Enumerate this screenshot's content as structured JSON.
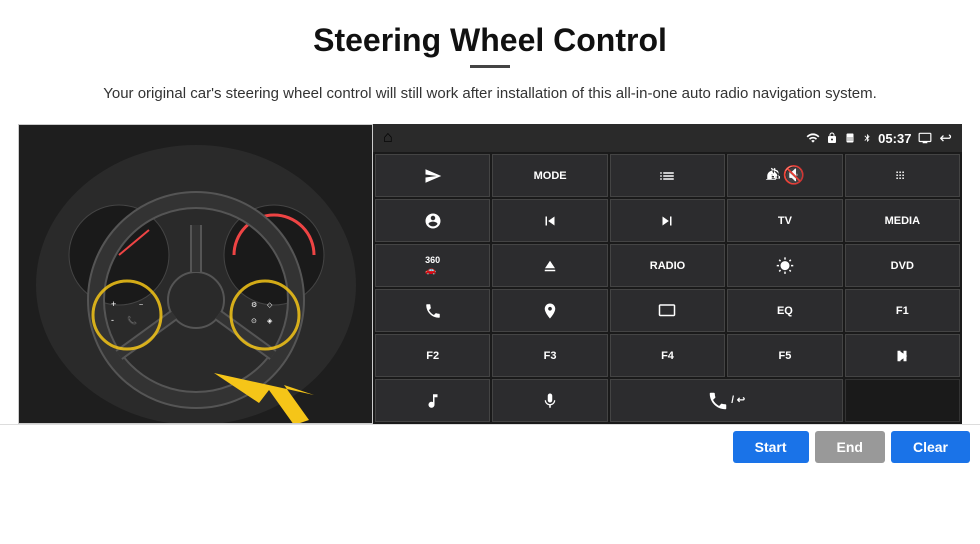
{
  "header": {
    "title": "Steering Wheel Control",
    "subtitle": "Your original car's steering wheel control will still work after installation of this all-in-one auto radio navigation system."
  },
  "status_bar": {
    "home_icon": "⌂",
    "time": "05:37",
    "back_icon": "↩"
  },
  "grid_buttons": [
    {
      "id": "r1c1",
      "icon": "arrow",
      "label": ""
    },
    {
      "id": "r1c2",
      "label": "MODE"
    },
    {
      "id": "r1c3",
      "icon": "list"
    },
    {
      "id": "r1c4",
      "icon": "mute"
    },
    {
      "id": "r1c5",
      "icon": "apps"
    },
    {
      "id": "r2c1",
      "icon": "settings-circle"
    },
    {
      "id": "r2c2",
      "icon": "prev"
    },
    {
      "id": "r2c3",
      "icon": "next"
    },
    {
      "id": "r2c4",
      "label": "TV"
    },
    {
      "id": "r2c5",
      "label": "MEDIA"
    },
    {
      "id": "r3c1",
      "icon": "360car"
    },
    {
      "id": "r3c2",
      "icon": "eject"
    },
    {
      "id": "r3c3",
      "label": "RADIO"
    },
    {
      "id": "r3c4",
      "icon": "brightness"
    },
    {
      "id": "r3c5",
      "label": "DVD"
    },
    {
      "id": "r4c1",
      "icon": "phone"
    },
    {
      "id": "r4c2",
      "icon": "nav"
    },
    {
      "id": "r4c3",
      "icon": "screen"
    },
    {
      "id": "r4c4",
      "label": "EQ"
    },
    {
      "id": "r4c5",
      "label": "F1"
    },
    {
      "id": "r5c1",
      "label": "F2"
    },
    {
      "id": "r5c2",
      "label": "F3"
    },
    {
      "id": "r5c3",
      "label": "F4"
    },
    {
      "id": "r5c4",
      "label": "F5"
    },
    {
      "id": "r5c5",
      "icon": "playpause"
    },
    {
      "id": "r6c1",
      "icon": "music"
    },
    {
      "id": "r6c2",
      "icon": "mic"
    },
    {
      "id": "r6c3",
      "icon": "call-end",
      "span": 2
    },
    {
      "id": "r6c5",
      "label": ""
    }
  ],
  "action_buttons": {
    "start": "Start",
    "end": "End",
    "clear": "Clear"
  }
}
